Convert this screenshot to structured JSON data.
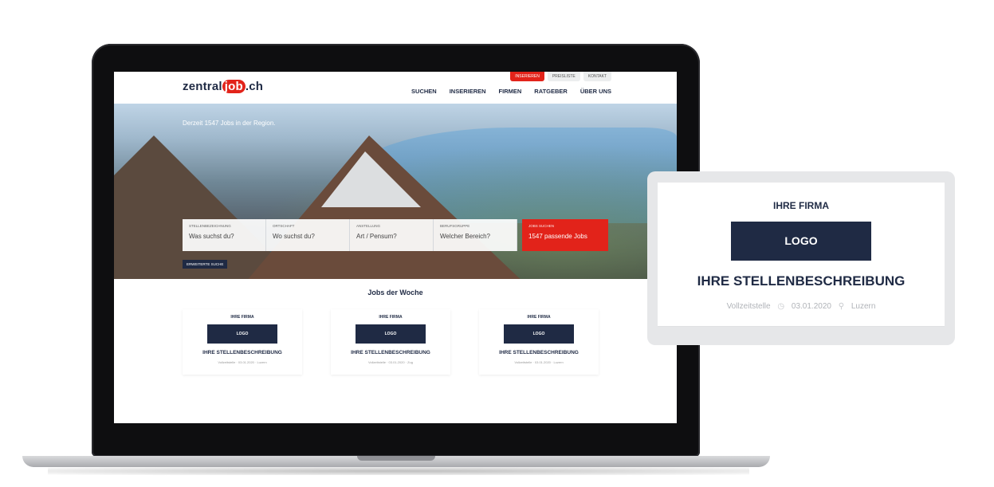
{
  "site": {
    "logo": {
      "part1": "zentral",
      "part2": "job",
      "part3": ".ch"
    },
    "top_util": [
      "INSERIEREN",
      "PREISLISTE",
      "KONTAKT"
    ],
    "nav": [
      "SUCHEN",
      "INSERIEREN",
      "FIRMEN",
      "RATGEBER",
      "ÜBER UNS"
    ],
    "hero": {
      "text": "Derzeit 1547 Jobs in der Region."
    },
    "search": {
      "fields": [
        {
          "label": "STELLENBEZEICHNUNG",
          "placeholder": "Was suchst du?"
        },
        {
          "label": "ORTSCHAFT",
          "placeholder": "Wo suchst du?"
        },
        {
          "label": "ANSTELLUNG",
          "placeholder": "Art / Pensum?"
        },
        {
          "label": "BERUFSGRUPPE",
          "placeholder": "Welcher Bereich?"
        }
      ],
      "submit_label": "JOBS SUCHEN",
      "submit_text": "1547 passende Jobs",
      "advanced": "ERWEITERTE SUCHE"
    },
    "jobs_title": "Jobs der Woche",
    "jobs": [
      {
        "firm": "IHRE FIRMA",
        "logo": "LOGO",
        "desc": "IHRE STELLENBESCHREIBUNG",
        "meta": "Vollzeitstelle · 03.01.2020 · Luzern"
      },
      {
        "firm": "IHRE FIRMA",
        "logo": "LOGO",
        "desc": "IHRE STELLENBESCHREIBUNG",
        "meta": "Vollzeitstelle · 03.01.2020 · Zug"
      },
      {
        "firm": "IHRE FIRMA",
        "logo": "LOGO",
        "desc": "IHRE STELLENBESCHREIBUNG",
        "meta": "Vollzeitstelle · 03.01.2020 · Luzern"
      }
    ]
  },
  "card": {
    "firm": "IHRE FIRMA",
    "logo": "LOGO",
    "desc": "IHRE STELLENBESCHREIBUNG",
    "type": "Vollzeitstelle",
    "date": "03.01.2020",
    "location": "Luzern"
  },
  "colors": {
    "accent": "#e2231a",
    "navy": "#1f2a44"
  }
}
